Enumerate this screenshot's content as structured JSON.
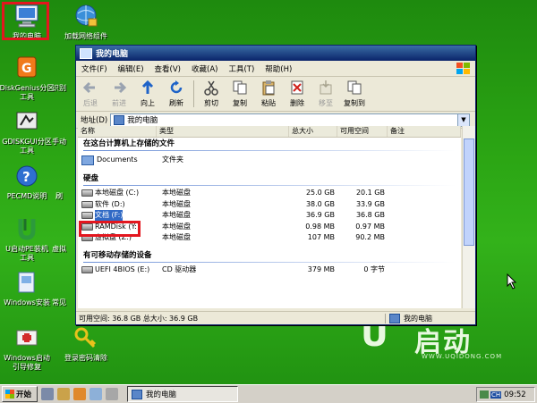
{
  "desktop": {
    "icons": [
      {
        "label": "我的电脑",
        "icon": "my-computer-icon"
      },
      {
        "label": "加载网络组件",
        "icon": "network-globe-icon"
      },
      {
        "label_line1": "DiskGenius分区",
        "label_line2": "工具",
        "icon": "diskgenius-icon"
      },
      {
        "label": "识别",
        "icon": "partial-icon"
      },
      {
        "label_line1": "GDISKGUI分区",
        "label_line2": "工具",
        "icon": "gdiskgui-icon"
      },
      {
        "label": "手动",
        "icon": "partial-icon"
      },
      {
        "label": "PECMD说明",
        "icon": "help-icon"
      },
      {
        "label": "刷",
        "icon": "partial-icon"
      },
      {
        "label_line1": "U启动PE装机",
        "label_line2": "工具",
        "icon": "installer-icon"
      },
      {
        "label": "虚拟",
        "icon": "partial-icon"
      },
      {
        "label": "Windows安装",
        "icon": "windows-install-icon"
      },
      {
        "label": "常见",
        "icon": "partial-icon"
      },
      {
        "label_line1": "Windows启动",
        "label_line2": "引导修复",
        "icon": "boot-repair-icon"
      },
      {
        "label": "登录密码清除",
        "icon": "key-icon"
      }
    ]
  },
  "brand": {
    "logo_text": "启动",
    "url": "WWW.UQIDONG.COM"
  },
  "window": {
    "title": "我的电脑",
    "menu": [
      "文件(F)",
      "编辑(E)",
      "查看(V)",
      "收藏(A)",
      "工具(T)",
      "帮助(H)"
    ],
    "toolbar": {
      "back": "后退",
      "forward": "前进",
      "up": "向上",
      "refresh": "刷新",
      "cut": "剪切",
      "copy": "复制",
      "paste": "粘贴",
      "delete": "删除",
      "move": "移至",
      "copy_to": "复制到"
    },
    "address": {
      "label": "地址(D)",
      "value": "我的电脑"
    },
    "columns": [
      "名称",
      "类型",
      "总大小",
      "可用空间",
      "备注"
    ],
    "groups": {
      "stored": "在这台计算机上存储的文件",
      "hdd": "硬盘",
      "removable": "有可移动存储的设备"
    },
    "stored_items": [
      {
        "name": "Documents",
        "type": "文件夹"
      }
    ],
    "drives": [
      {
        "name": "本地磁盘 (C:)",
        "type": "本地磁盘",
        "total": "25.0 GB",
        "free": "20.1 GB"
      },
      {
        "name": "软件 (D:)",
        "type": "本地磁盘",
        "total": "38.0 GB",
        "free": "33.9 GB"
      },
      {
        "name": "文档 (F:)",
        "type": "本地磁盘",
        "total": "36.9 GB",
        "free": "36.8 GB"
      },
      {
        "name": "RAMDisk (Y:)",
        "type": "本地磁盘",
        "total": "0.98 MB",
        "free": "0.97 MB"
      },
      {
        "name": "虚拟盘 (Z:)",
        "type": "本地磁盘",
        "total": "107 MB",
        "free": "90.2 MB"
      }
    ],
    "removable": [
      {
        "name": "UEFI 4BIOS (E:)",
        "type": "CD 驱动器",
        "total": "379 MB",
        "free": "0 字节"
      }
    ],
    "status": {
      "left": "可用空间: 36.8 GB 总大小: 36.9 GB",
      "right": "我的电脑"
    }
  },
  "taskbar": {
    "start": "开始",
    "window_button": "我的电脑",
    "lang": "CH",
    "time": "09:52"
  }
}
